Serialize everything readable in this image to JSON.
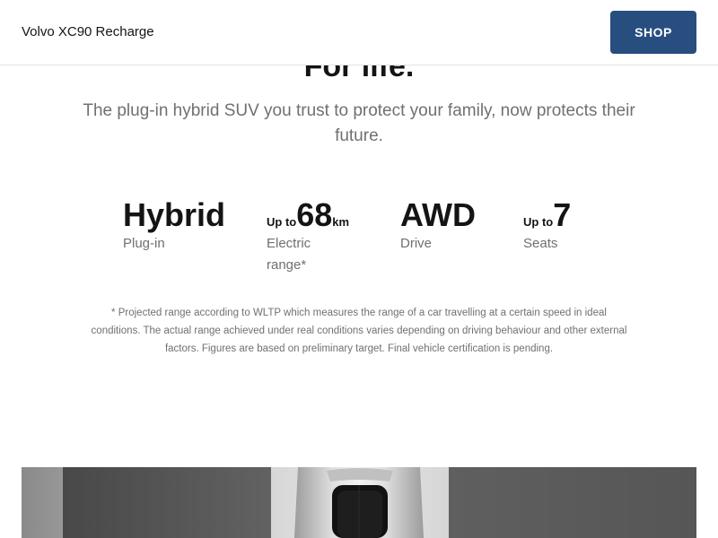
{
  "header": {
    "title": "Volvo XC90 Recharge",
    "shop_label": "SHOP"
  },
  "hero": {
    "heading": "For life.",
    "subtitle": "The plug-in hybrid SUV you trust to protect your family, now protects their future."
  },
  "specs": [
    {
      "prefix": "",
      "value": "Hybrid",
      "suffix": "",
      "label": "Plug-in"
    },
    {
      "prefix": "Up to",
      "value": "68",
      "suffix": "km",
      "label": "Electric range*"
    },
    {
      "prefix": "",
      "value": "AWD",
      "suffix": "",
      "label": "Drive"
    },
    {
      "prefix": "Up to",
      "value": "7",
      "suffix": "",
      "label": "Seats"
    }
  ],
  "footnote": "* Projected range according to WLTP which measures the range of a car travelling at a certain speed in ideal conditions. The actual range achieved under real conditions varies depending on driving behaviour and other external factors. Figures are based on preliminary target. Final vehicle certification is pending.",
  "colors": {
    "accent": "#284e80",
    "text": "#141414",
    "muted": "#707070",
    "divider": "#e3e3e3"
  }
}
